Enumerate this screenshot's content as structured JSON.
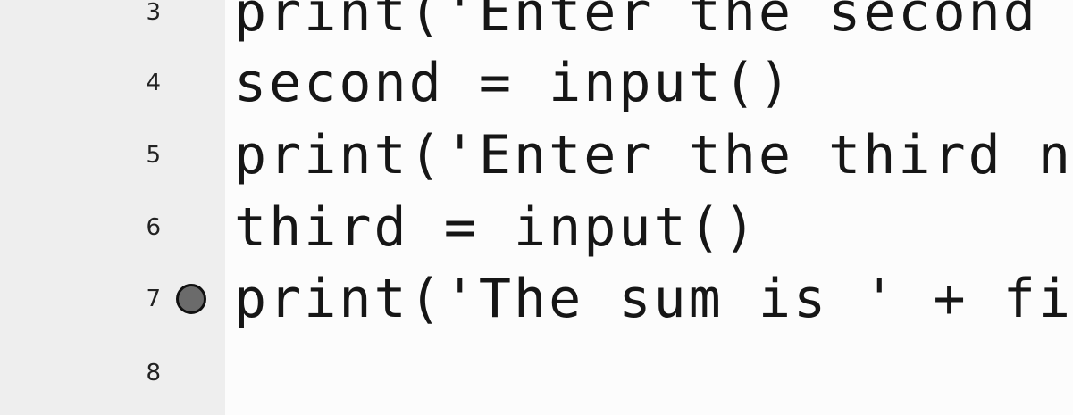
{
  "editor": {
    "lines": [
      {
        "number": "3",
        "code": "print('Enter the second",
        "breakpoint": false
      },
      {
        "number": "4",
        "code": "second = input()",
        "breakpoint": false
      },
      {
        "number": "5",
        "code": "print('Enter the third nu",
        "breakpoint": false
      },
      {
        "number": "6",
        "code": "third = input()",
        "breakpoint": false
      },
      {
        "number": "7",
        "code": "print('The sum is ' + fi",
        "breakpoint": true
      },
      {
        "number": "8",
        "code": "",
        "breakpoint": false
      }
    ]
  },
  "colors": {
    "gutter_bg": "#eeeeee",
    "code_bg": "#fcfcfc",
    "text": "#161616",
    "breakpoint_fill": "#6b6b6b"
  },
  "icons": {
    "breakpoint": "breakpoint-icon"
  }
}
